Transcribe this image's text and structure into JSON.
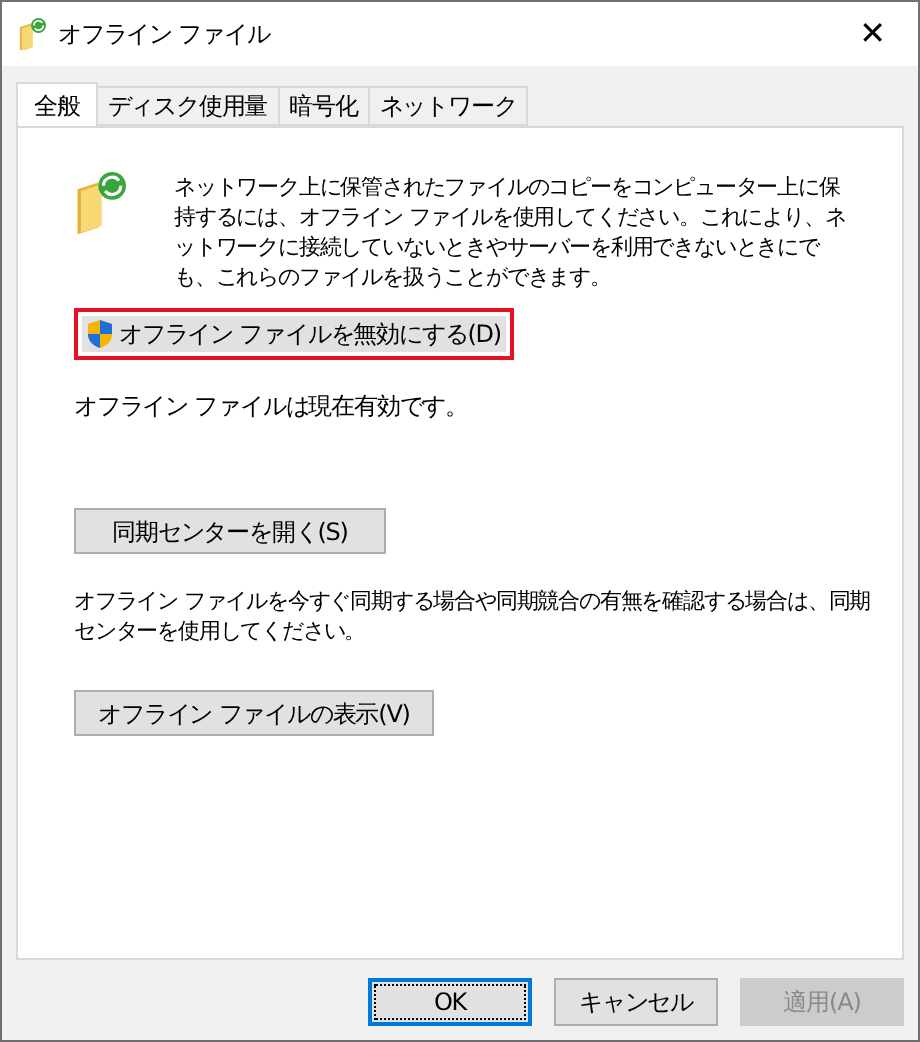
{
  "window": {
    "title": "オフライン ファイル",
    "close": "✕"
  },
  "tabs": [
    {
      "label": "全般",
      "selected": true
    },
    {
      "label": "ディスク使用量",
      "selected": false
    },
    {
      "label": "暗号化",
      "selected": false
    },
    {
      "label": "ネットワーク",
      "selected": false
    }
  ],
  "intro": "ネットワーク上に保管されたファイルのコピーをコンピューター上に保持するには、オフライン ファイルを使用してください。これにより、ネットワークに接続していないときやサーバーを利用できないときにでも、これらのファイルを扱うことができます。",
  "disable_button": {
    "label": "オフライン ファイルを無効にする(D)",
    "highlighted": true
  },
  "status": "オフライン ファイルは現在有効です。",
  "sync_button": {
    "label": "同期センターを開く(S)"
  },
  "sync_note": "オフライン ファイルを今すぐ同期する場合や同期競合の有無を確認する場合は、同期センターを使用してください。",
  "view_button": {
    "label": "オフライン ファイルの表示(V)"
  },
  "buttons": [
    {
      "label": "OK",
      "default": true,
      "disabled": false
    },
    {
      "label": "キャンセル",
      "default": false,
      "disabled": false
    },
    {
      "label": "適用(A)",
      "default": false,
      "disabled": true
    }
  ]
}
